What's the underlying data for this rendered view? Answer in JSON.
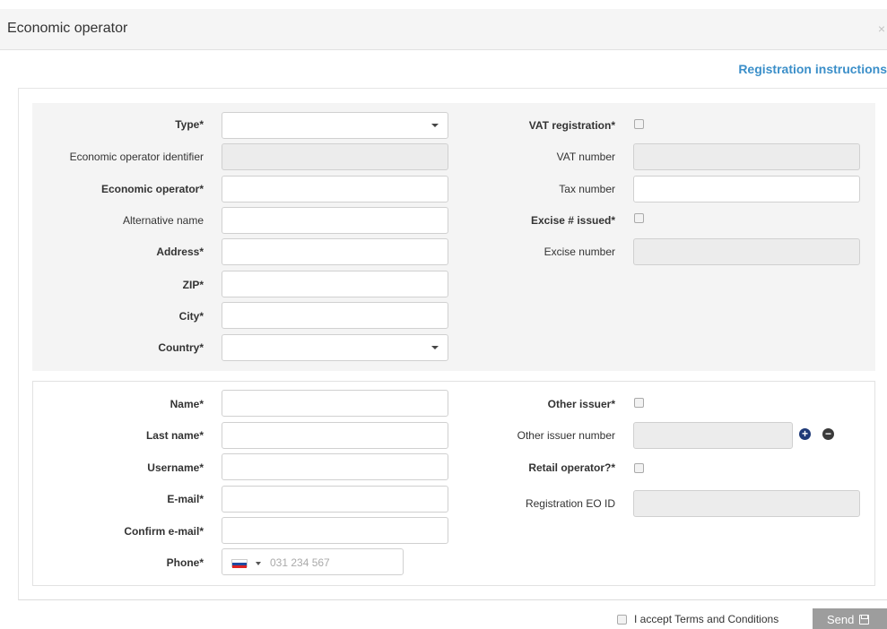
{
  "dialog": {
    "title": "Economic operator",
    "close_label": "×",
    "instructions_link": "Registration instructions"
  },
  "section_operator": {
    "type_label": "Type*",
    "type_value": "",
    "eo_identifier_label": "Economic operator identifier",
    "eo_name_label": "Economic operator*",
    "alt_name_label": "Alternative name",
    "address_label": "Address*",
    "zip_label": "ZIP*",
    "city_label": "City*",
    "country_label": "Country*",
    "country_value": "",
    "vat_reg_label": "VAT registration*",
    "vat_number_label": "VAT number",
    "tax_number_label": "Tax number",
    "excise_issued_label": "Excise # issued*",
    "excise_number_label": "Excise number"
  },
  "section_user": {
    "name_label": "Name*",
    "last_name_label": "Last name*",
    "username_label": "Username*",
    "email_label": "E-mail*",
    "confirm_email_label": "Confirm e-mail*",
    "phone_label": "Phone*",
    "phone_placeholder": "031 234 567",
    "other_issuer_label": "Other issuer*",
    "other_issuer_number_label": "Other issuer number",
    "retail_operator_label": "Retail operator?*",
    "registration_eo_id_label": "Registration EO ID"
  },
  "footer": {
    "terms_label": "I accept Terms and Conditions",
    "send_label": "Send"
  },
  "icons": {
    "add": "plus-circle-icon",
    "remove": "minus-circle-icon",
    "save": "floppy-disk-icon",
    "flag": "slovenia-flag-icon",
    "dropdown": "caret-down-icon"
  },
  "colors": {
    "link": "#3b8fc9",
    "header_bg": "#f5f5f5",
    "section_bg": "#f4f4f4",
    "send_button_bg": "#9d9d9d",
    "add_button": "#1f3a78",
    "remove_button": "#3a3a3a"
  }
}
